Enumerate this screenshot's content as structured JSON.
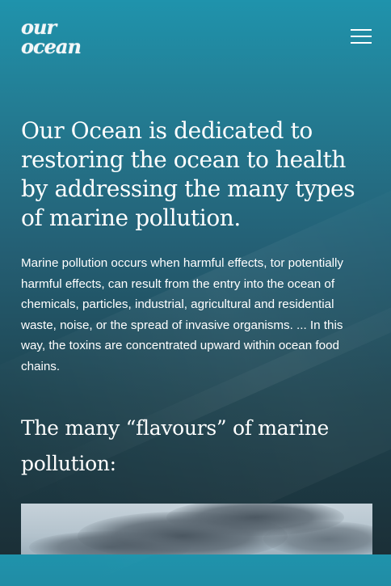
{
  "header": {
    "logo_line1": "our",
    "logo_line2": "ocean",
    "menu_icon": "hamburger-menu-icon"
  },
  "intro": {
    "heading": "Our Ocean is dedicated to restoring the ocean to health by addressing the many types of marine pollution.",
    "body": "Marine pollution occurs when harmful effects, tor potentially harmful effects, can result from the entry into the ocean of chemicals, particles, industrial, agricultural and residential waste, noise, or the spread of invasive organisms. ... In this way, the toxins are concentrated upward within ocean food chains."
  },
  "section": {
    "heading": "The many “flavours” of marine pollution:"
  },
  "colors": {
    "gradient_top": "#1f93ac",
    "gradient_bottom": "#1b2f37",
    "text": "#ffffff"
  }
}
